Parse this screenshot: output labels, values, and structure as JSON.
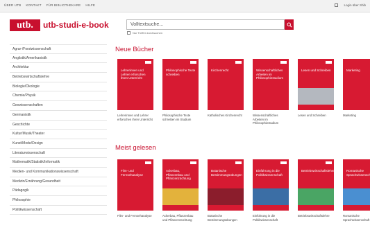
{
  "topbar": {
    "links": [
      "ÜBER UTB",
      "KONTAKT",
      "FÜR BIBLIOTHEKARE",
      "HILFE"
    ],
    "right_label": "Login über Shib"
  },
  "header": {
    "logo": "utb.",
    "brand": "utb-studi-e-book",
    "search_placeholder": "Volltextsuche...",
    "checkbox_label": "Nur Treffer durchsuchen"
  },
  "sidebar": {
    "items": [
      "Agrar-/Forstwissenschaft",
      "Anglistik/Amerikanistik",
      "Architektur",
      "Betriebswirtschaftslehre",
      "Biologie/Ökologie",
      "Chemie/Physik",
      "Geowissenschaften",
      "Germanistik",
      "Geschichte",
      "Kultur/Musik/Theater",
      "Kunst/Mode/Design",
      "Literaturwissenschaft",
      "Mathematik/Statistik/Informatik",
      "Medien- und Kommunikationswissenschaft",
      "Medizin/Ernährung/Gesundheit",
      "Pädagogik",
      "Philosophie",
      "Politikwissenschaft"
    ]
  },
  "new_books": {
    "title": "Neue Bücher",
    "books": [
      {
        "cover": "Lehrerinnen und Lehrer erforschen ihren Unterricht",
        "caption": "Lehrerinnen und Lehrer erforschen ihren Unterricht",
        "band": "#d71a32"
      },
      {
        "cover": "Philosophische Texte schreiben",
        "caption": "Philosophische Texte schreiben im Studium",
        "band": "#d71a32"
      },
      {
        "cover": "Kirchenrecht",
        "caption": "Katholisches Kirchenrecht",
        "band": "#d71a32"
      },
      {
        "cover": "Wissenschaftliches Arbeiten im Philosophiestudium",
        "caption": "Wissenschaftliches Arbeiten im Philosophiestudium",
        "band": "#d71a32"
      },
      {
        "cover": "Lesen und Schreiben",
        "caption": "Lesen und Schreiben",
        "band": "#b4b8bf"
      },
      {
        "cover": "Marketing",
        "caption": "Marketing",
        "band": "#d71a32"
      }
    ]
  },
  "most_read": {
    "title": "Meist gelesen",
    "books": [
      {
        "cover": "Film- und Fernsehanalyse",
        "caption": "Film- und Fernsehanalyse",
        "band": "#d71a32"
      },
      {
        "cover": "Ackerbau, Pflanzenbau und Pflanzenzüchtung",
        "caption": "Ackerbau, Pflanzenbau und Pflanzenzüchtung",
        "band": "#e3b23c"
      },
      {
        "cover": "Botanische Bestimmungsübungen",
        "caption": "Botanische Bestimmungsübungen",
        "band": "#8b1d2c"
      },
      {
        "cover": "Einführung in die Politikwissenschaft",
        "caption": "Einführung in die Politikwissenschaft",
        "band": "#3b6ea5"
      },
      {
        "cover": "Betriebswirtschaftslehre",
        "caption": "Betriebswirtschaftslehre",
        "band": "#4aa564"
      },
      {
        "cover": "Romanische Sprachwissenschaft",
        "caption": "Romanische Sprachwissenschaft",
        "band": "#4a8fd1"
      }
    ]
  },
  "colors": {
    "accent": "#c8102e",
    "cover_red": "#d71a32"
  }
}
